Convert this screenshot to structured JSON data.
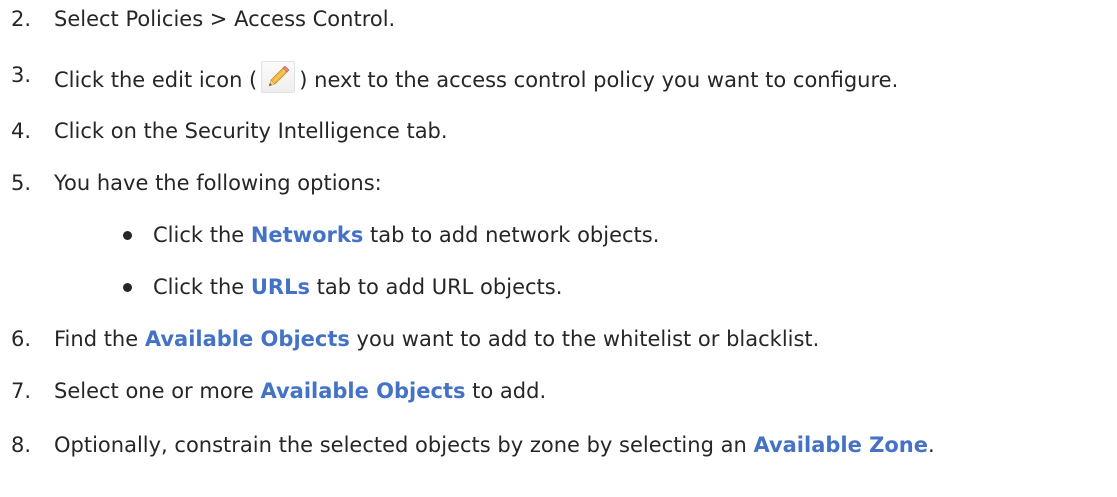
{
  "steps": [
    {
      "num": "2.",
      "text": "Select Policies > Access Control."
    },
    {
      "num": "3.",
      "pre": "Click the edit icon (",
      "post": ") next to the access control policy you want to configure.",
      "icon": "pencil-edit-icon"
    },
    {
      "num": "4.",
      "text": "Click on the Security Intelligence tab."
    },
    {
      "num": "5.",
      "text": "You have the following options:"
    },
    {
      "num": "6.",
      "pre": "Find the ",
      "hl": "Available Objects",
      "post": " you want to add to the whitelist or blacklist."
    },
    {
      "num": "7.",
      "pre": "Select one or more ",
      "hl": "Available Objects",
      "post": " to add."
    },
    {
      "num": "8.",
      "pre": "Optionally, constrain the selected objects by zone by selecting an ",
      "hl": "Available Zone",
      "post": "."
    }
  ],
  "bullets": [
    {
      "pre": "Click the ",
      "hl": "Networks",
      "post": " tab to add network objects."
    },
    {
      "pre": "Click the ",
      "hl": "URLs",
      "post": " tab to add URL objects."
    }
  ],
  "colors": {
    "text": "#262626",
    "highlight": "#4472c4",
    "pencil_body": "#f2b53a",
    "pencil_tip": "#f3d59a"
  }
}
